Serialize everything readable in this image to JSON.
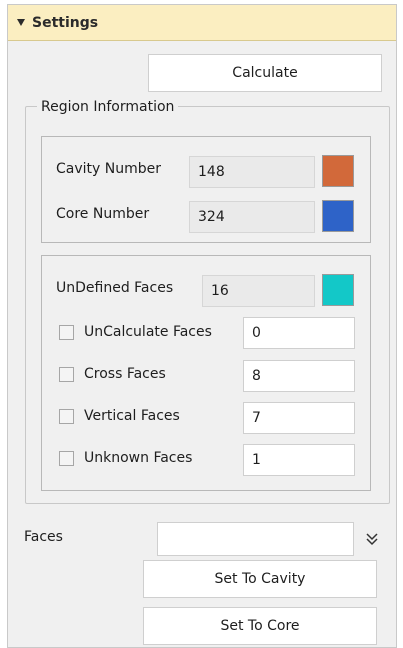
{
  "settings": {
    "title": "Settings",
    "calculate_label": "Calculate"
  },
  "region": {
    "title": "Region Information",
    "cavity_label": "Cavity Number",
    "cavity_value": "148",
    "cavity_color": "#d2693a",
    "core_label": "Core Number",
    "core_value": "324",
    "core_color": "#2e63c8"
  },
  "faces": {
    "undefined_label": "UnDefined Faces",
    "undefined_value": "16",
    "undefined_color": "#13c8c8",
    "items": [
      {
        "label": "UnCalculate Faces",
        "value": "0",
        "checked": false
      },
      {
        "label": "Cross Faces",
        "value": "8",
        "checked": false
      },
      {
        "label": "Vertical Faces",
        "value": "7",
        "checked": false
      },
      {
        "label": "Unknown Faces",
        "value": "1",
        "checked": false
      }
    ]
  },
  "bottom": {
    "faces_label": "Faces",
    "faces_value": "",
    "expand_icon": "double-chevron-down-icon",
    "set_cavity_label": "Set To Cavity",
    "set_core_label": "Set To Core"
  }
}
